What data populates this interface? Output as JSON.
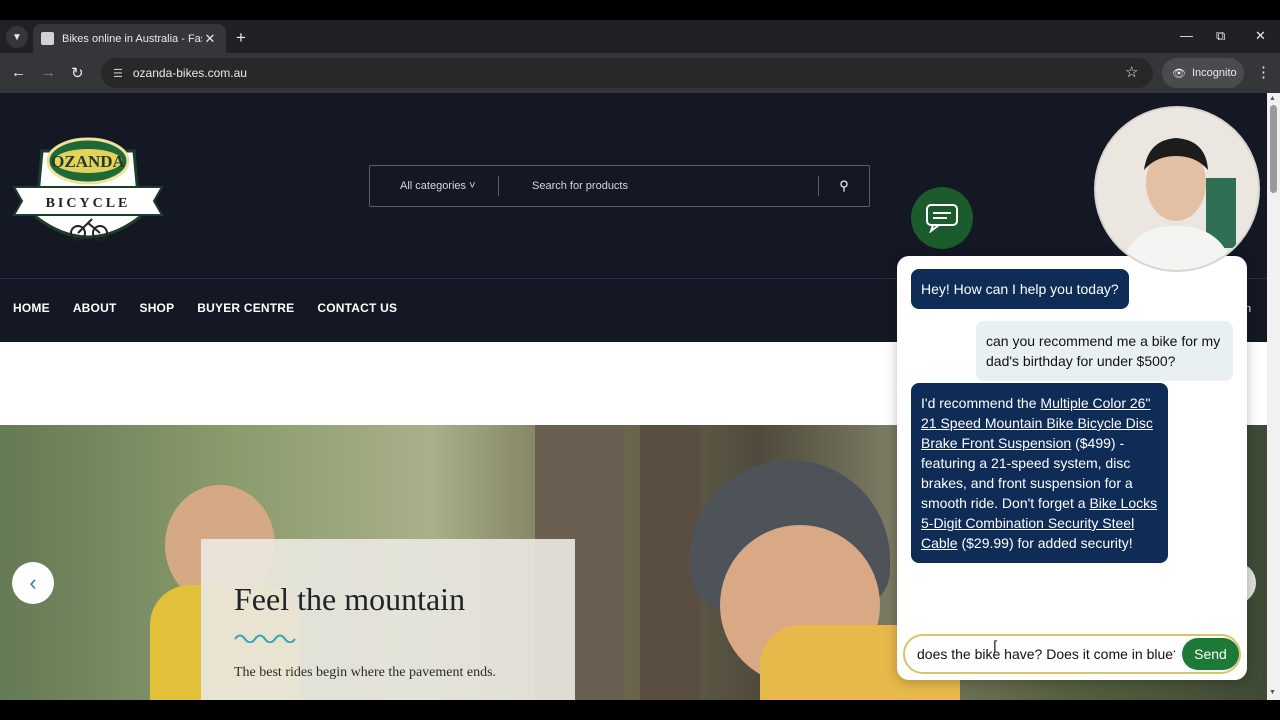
{
  "browser": {
    "tab_title": "Bikes online in Australia - Fast D",
    "url": "ozanda-bikes.com.au",
    "incognito_label": "Incognito",
    "icons": [
      "tab-search-icon",
      "favicon",
      "close-tab-icon",
      "new-tab-icon",
      "minimize-icon",
      "restore-icon",
      "close-window-icon",
      "back-icon",
      "forward-icon",
      "reload-icon",
      "site-info-icon",
      "bookmark-star-icon",
      "incognito-icon",
      "menu-kebab-icon"
    ]
  },
  "site": {
    "logo": {
      "brand": "OZANDA",
      "sub": "BICYCLE"
    },
    "search": {
      "category": "All categories",
      "placeholder": "Search for products"
    },
    "menu": [
      "HOME",
      "ABOUT",
      "SHOP",
      "BUYER CENTRE",
      "CONTACT US"
    ],
    "login_fragment": "n",
    "hero": {
      "title": "Feel the mountain",
      "subtitle": "The best rides begin where the pavement ends."
    }
  },
  "chat": {
    "greeting": "Hey! How can I help you today?",
    "user_message": "can you recommend me a bike for my dad's birthday for under $500?",
    "bot_reply": {
      "intro": "I'd recommend the ",
      "product1": "Multiple Color 26\" 21 Speed Mountain Bike Bicycle Disc Brake Front Suspension",
      "mid": " ($499) - featuring a 21-speed system, disc brakes, and front suspension for a smooth ride. Don't forget a ",
      "product2": "Bike Locks 5-Digit Combination Security Steel Cable",
      "end": " ($29.99) for added security!"
    },
    "input_value": "does the bike have? Does it come in blue?",
    "send_label": "Send"
  },
  "colors": {
    "header_bg": "#141824",
    "chat_bot_bubble": "#0e2c55",
    "send_button": "#1d7a36",
    "chat_fab": "#1c5b2c"
  }
}
